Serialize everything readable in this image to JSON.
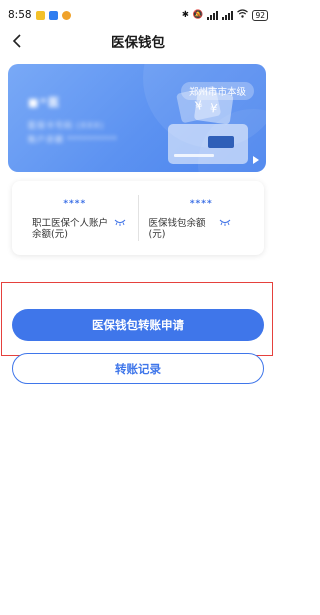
{
  "status_bar": {
    "time": "8:58",
    "battery": "92",
    "colors": {
      "app1": "#f3c12a",
      "app2": "#2f7df0",
      "app3": "#f0a22a"
    }
  },
  "nav": {
    "title": "医保钱包",
    "back_icon": "chevron-left-icon"
  },
  "card": {
    "region_badge": "郑州市市本级",
    "holder_name": "■*医",
    "line1": "医保卡号码 (XXX)",
    "line2": "账户余额 **********"
  },
  "balances": [
    {
      "amount": "****",
      "label": "职工医保个人账户余额(元)",
      "eye_icon": "eye-closed-icon"
    },
    {
      "amount": "****",
      "label": "医保钱包余额(元)",
      "eye_icon": "eye-closed-icon"
    }
  ],
  "actions": {
    "transfer_label": "医保钱包转账申请",
    "records_label": "转账记录"
  },
  "colors": {
    "primary": "#3f76ea",
    "highlight": "#e5413d"
  }
}
